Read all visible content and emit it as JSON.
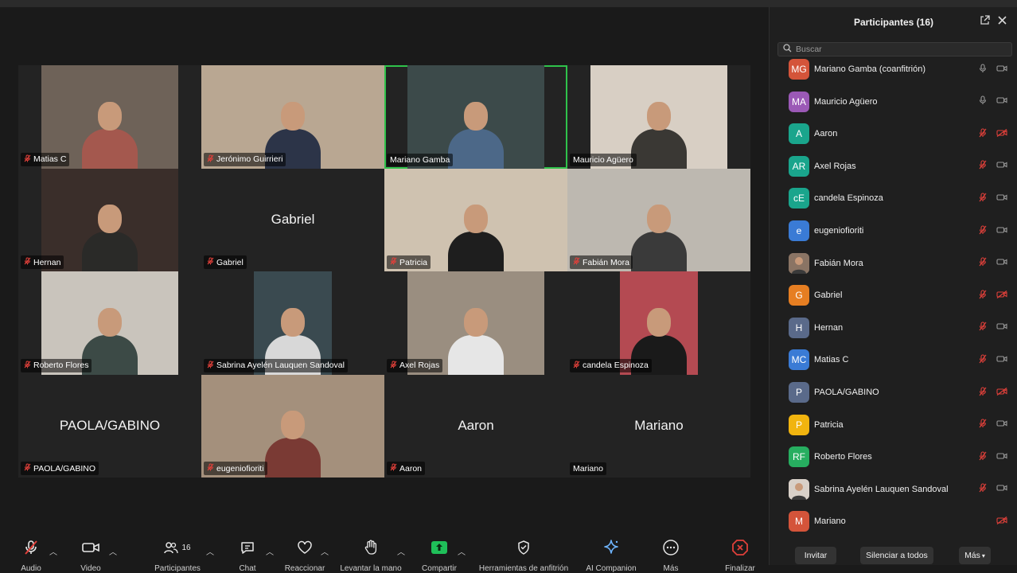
{
  "tiles": [
    {
      "name": "Matias C",
      "muted": true,
      "video": true,
      "bg": "#6e6258",
      "shirt": "#a4584e"
    },
    {
      "name": "Jerónimo Guirrieri",
      "muted": true,
      "video": true,
      "wide": true,
      "bg": "#b9a792",
      "shirt": "#2c3448"
    },
    {
      "name": "Mariano Gamba",
      "muted": false,
      "active": true,
      "video": true,
      "bg": "#3c4a4a",
      "shirt": "#4c6888"
    },
    {
      "name": "Mauricio Agüero",
      "muted": false,
      "video": true,
      "bg": "#d8cfc4",
      "shirt": "#3a3834"
    },
    {
      "name": "Hernan",
      "muted": true,
      "video": true,
      "bg": "#3a2e2a",
      "shirt": "#2a2a28"
    },
    {
      "name": "Gabriel",
      "muted": true,
      "video": false,
      "big": "Gabriel"
    },
    {
      "name": "Patricia",
      "muted": true,
      "video": true,
      "wide": true,
      "bg": "#cfc2b0",
      "shirt": "#1e1e1e"
    },
    {
      "name": "Fabián Mora",
      "muted": true,
      "video": true,
      "wide": true,
      "bg": "#bdb8b0",
      "shirt": "#3a3a3a"
    },
    {
      "name": "Roberto Flores",
      "muted": true,
      "video": true,
      "bg": "#c9c4bc",
      "shirt": "#3c4a46"
    },
    {
      "name": "Sabrina Ayelén Lauquen Sandoval",
      "muted": true,
      "video": true,
      "w98": true,
      "bg": "#3a4a50",
      "shirt": "#d8d8d8"
    },
    {
      "name": "Axel Rojas",
      "muted": true,
      "video": true,
      "bg": "#9a8e80",
      "shirt": "#e6e6e6"
    },
    {
      "name": "candela Espinoza",
      "muted": true,
      "video": true,
      "w98": true,
      "bg": "#b44a52",
      "shirt": "#1a1a1a"
    },
    {
      "name": "PAOLA/GABINO",
      "muted": true,
      "video": false,
      "big": "PAOLA/GABINO"
    },
    {
      "name": "eugeniofioriti",
      "muted": true,
      "video": true,
      "wide": true,
      "bg": "#a4907c",
      "shirt": "#7a3a34"
    },
    {
      "name": "Aaron",
      "muted": true,
      "video": false,
      "big": "Aaron"
    },
    {
      "name": "Mariano",
      "muted": false,
      "video": false,
      "big": "Mariano"
    }
  ],
  "toolbar": {
    "audio": "Audio",
    "video": "Video",
    "participants": "Participantes",
    "participants_count": "16",
    "chat": "Chat",
    "react": "Reaccionar",
    "raise_hand": "Levantar la mano",
    "share": "Compartir",
    "host_tools": "Herramientas de anfitrión",
    "companion": "AI Companion",
    "more": "Más",
    "end": "Finalizar"
  },
  "panel": {
    "title": "Participantes (16)",
    "search_placeholder": "Buscar",
    "invite": "Invitar",
    "mute_all": "Silenciar a todos",
    "more": "Más"
  },
  "participants": [
    {
      "initials": "MG",
      "name": "Mariano Gamba (coanfitrión)",
      "color": "#d4543a",
      "mic": "on",
      "cam": "on"
    },
    {
      "initials": "MA",
      "name": "Mauricio Agüero",
      "color": "#9b59b6",
      "mic": "on",
      "cam": "on"
    },
    {
      "initials": "A",
      "name": "Aaron",
      "color": "#1aa58c",
      "mic": "off",
      "cam": "off"
    },
    {
      "initials": "AR",
      "name": "Axel Rojas",
      "color": "#1aa58c",
      "mic": "off",
      "cam": "on"
    },
    {
      "initials": "cE",
      "name": "candela Espinoza",
      "color": "#1aa58c",
      "mic": "off",
      "cam": "on"
    },
    {
      "initials": "e",
      "name": "eugeniofioriti",
      "color": "#3a7bd5",
      "mic": "off",
      "cam": "on"
    },
    {
      "initials": "",
      "name": "Fabián Mora",
      "color": "#8a7464",
      "photo": true,
      "mic": "off",
      "cam": "on"
    },
    {
      "initials": "G",
      "name": "Gabriel",
      "color": "#e67e22",
      "mic": "off",
      "cam": "off"
    },
    {
      "initials": "H",
      "name": "Hernan",
      "color": "#5a6a8a",
      "mic": "off",
      "cam": "on"
    },
    {
      "initials": "MC",
      "name": "Matias C",
      "color": "#3a7bd5",
      "mic": "off",
      "cam": "on"
    },
    {
      "initials": "P",
      "name": "PAOLA/GABINO",
      "color": "#5a6a8a",
      "mic": "off",
      "cam": "off"
    },
    {
      "initials": "P",
      "name": "Patricia",
      "color": "#f1b40f",
      "mic": "off",
      "cam": "on"
    },
    {
      "initials": "RF",
      "name": "Roberto Flores",
      "color": "#27ae60",
      "mic": "off",
      "cam": "on"
    },
    {
      "initials": "",
      "name": "Sabrina Ayelén Lauquen Sandoval",
      "color": "#d8d0c8",
      "photo": true,
      "mic": "off",
      "cam": "on"
    },
    {
      "initials": "M",
      "name": "Mariano",
      "color": "#d4543a",
      "mic": "none",
      "cam": "off"
    }
  ]
}
